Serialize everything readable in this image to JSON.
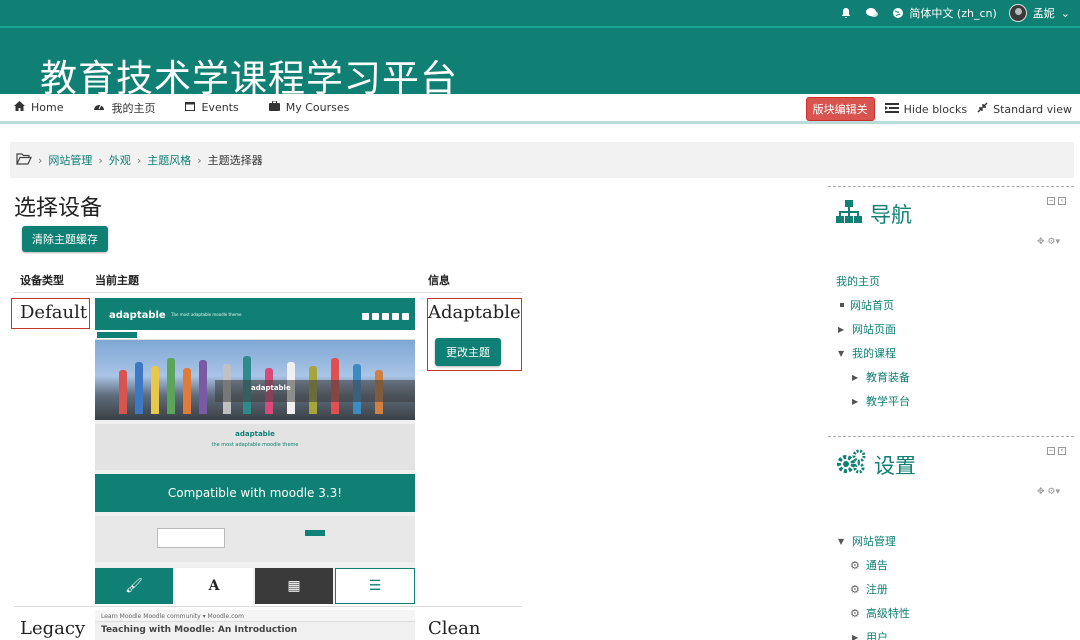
{
  "topbar": {
    "language": "简体中文 (zh_cn)",
    "username": "孟妮",
    "icons": [
      "bell-icon",
      "chat-icon",
      "globe-icon",
      "chevron-down-icon"
    ]
  },
  "banner": {
    "title": "教育技术学课程学习平台"
  },
  "nav": {
    "home": "Home",
    "dashboard": "我的主页",
    "events": "Events",
    "courses": "My Courses",
    "edit_blocks": "版块编辑关",
    "hide_blocks": "Hide blocks",
    "standard_view": "Standard view"
  },
  "breadcrumb": [
    "网站管理",
    "外观",
    "主题风格",
    "主题选择器"
  ],
  "main": {
    "heading": "选择设备",
    "clear_cache": "清除主题缓存",
    "columns": [
      "设备类型",
      "当前主题",
      "信息"
    ],
    "rows": [
      {
        "device": "Default",
        "theme_name": "Adaptable",
        "change_label": "更改主题"
      },
      {
        "device": "Legacy",
        "theme_name": "Clean"
      }
    ]
  },
  "preview": {
    "logo": "adaptable",
    "tagline": "The most adaptable moodle theme",
    "photo_caption": "adaptable",
    "light_title": "adaptable",
    "light_sub": "the most adaptable moodle theme",
    "band_text": "Compatible with moodle 3.3!",
    "tiles": [
      "Colors",
      "Fonts",
      "Frontpage",
      "Course list"
    ]
  },
  "legacy_preview": {
    "bar": "Learn Moodle    Moodle community ▾    Moodle.com",
    "text": "Teaching with Moodle: An Introduction"
  },
  "sidebar": {
    "navigation": {
      "title": "导航",
      "items": [
        {
          "label": "我的主页",
          "level": 0,
          "marker": "none"
        },
        {
          "label": "网站首页",
          "level": 1,
          "marker": "square"
        },
        {
          "label": "网站页面",
          "level": 1,
          "marker": "right"
        },
        {
          "label": "我的课程",
          "level": 1,
          "marker": "down"
        },
        {
          "label": "教育装备",
          "level": 2,
          "marker": "right"
        },
        {
          "label": "教学平台",
          "level": 2,
          "marker": "right"
        }
      ]
    },
    "settings": {
      "title": "设置",
      "items": [
        {
          "label": "网站管理",
          "level": 1,
          "marker": "down"
        },
        {
          "label": "通告",
          "level": 2,
          "marker": "gear"
        },
        {
          "label": "注册",
          "level": 2,
          "marker": "gear"
        },
        {
          "label": "高级特性",
          "level": 2,
          "marker": "gear"
        },
        {
          "label": "用户",
          "level": 2,
          "marker": "right"
        }
      ]
    }
  },
  "colors": {
    "brand": "#0f8073",
    "danger": "#d9534f"
  }
}
